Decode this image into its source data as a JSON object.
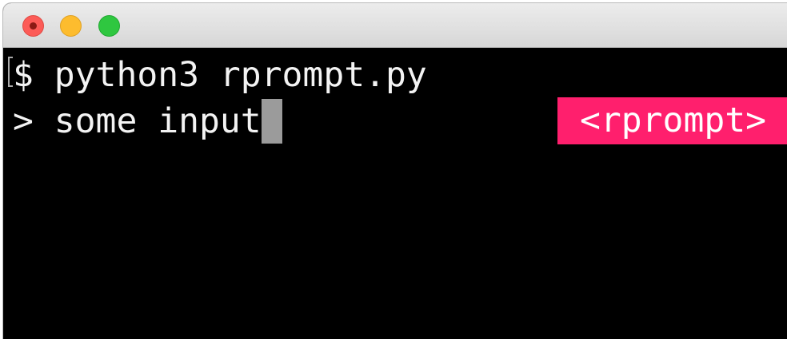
{
  "window": {
    "traffic_lights": [
      "close",
      "minimize",
      "zoom"
    ]
  },
  "terminal": {
    "line1": "$ python3 rprompt.py",
    "line2": "> some input",
    "rprompt": "<rprompt>"
  },
  "colors": {
    "background": "#000000",
    "text": "#f3f3f3",
    "rprompt_background": "#ff1f6d",
    "cursor": "#9b9b9b"
  }
}
